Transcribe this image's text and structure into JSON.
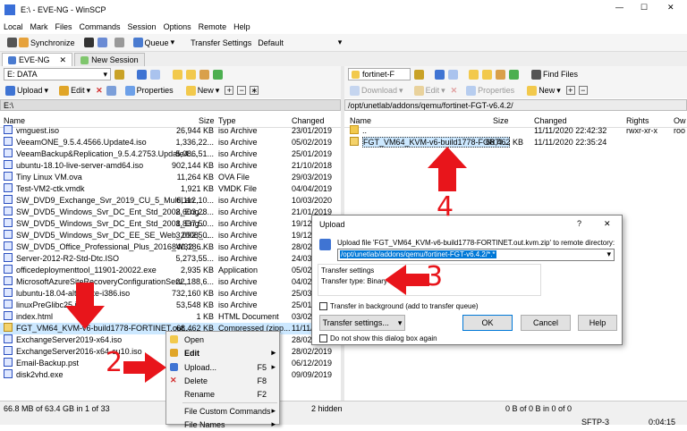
{
  "window": {
    "title": "E:\\ - EVE-NG - WinSCP"
  },
  "menu": [
    "Local",
    "Mark",
    "Files",
    "Commands",
    "Session",
    "Options",
    "Remote",
    "Help"
  ],
  "toolbar": {
    "synchronize": "Synchronize",
    "queue": "Queue",
    "transfer_settings": "Transfer Settings",
    "transfer_value": "Default"
  },
  "tabs": {
    "session": "EVE-NG",
    "new_session": "New Session"
  },
  "left": {
    "drive": "E: DATA",
    "upload": "Upload",
    "edit": "Edit",
    "properties": "Properties",
    "new": "New",
    "path": "E:\\",
    "columns": {
      "name": "Name",
      "size": "Size",
      "type": "Type",
      "changed": "Changed"
    },
    "rows": [
      {
        "name": "vmguest.iso",
        "size": "26,944 KB",
        "type": "iso Archive",
        "changed": "23/01/2019"
      },
      {
        "name": "VeeamONE_9.5.4.4566.Update4.iso",
        "size": "1,336,22...",
        "type": "iso Archive",
        "changed": "05/02/2019"
      },
      {
        "name": "VeeamBackup&Replication_9.5.4.2753.Update4....",
        "size": "5,086,51...",
        "type": "iso Archive",
        "changed": "25/01/2019"
      },
      {
        "name": "ubuntu-18.10-live-server-amd64.iso",
        "size": "902,144 KB",
        "type": "iso Archive",
        "changed": "21/10/2018"
      },
      {
        "name": "Tiny Linux VM.ova",
        "size": "11,264 KB",
        "type": "OVA File",
        "changed": "29/03/2019"
      },
      {
        "name": "Test-VM2-ctk.vmdk",
        "size": "1,921 KB",
        "type": "VMDK File",
        "changed": "04/04/2019"
      },
      {
        "name": "SW_DVD9_Exchange_Svr_2019_CU_5_MultiLan...",
        "size": "6,112,10...",
        "type": "iso Archive",
        "changed": "10/03/2020"
      },
      {
        "name": "SW_DVD5_Windows_Svr_DC_Ent_Std_2008_Eng...",
        "size": "2,603,28...",
        "type": "iso Archive",
        "changed": "21/01/2019"
      },
      {
        "name": "SW_DVD5_Windows_Svr_DC_Ent_Std_2008_Eng...",
        "size": "1,837,50...",
        "type": "iso Archive",
        "changed": "19/12/2018"
      },
      {
        "name": "SW_DVD5_Windows_Svr_DC_EE_SE_Web_2008_...",
        "size": "3,092,50...",
        "type": "iso Archive",
        "changed": "19/12/2018"
      },
      {
        "name": "SW_DVD5_Office_Professional_Plus_2016_W32_...",
        "size": "840,186 KB",
        "type": "iso Archive",
        "changed": "28/02/2019"
      },
      {
        "name": "Server-2012-R2-Std-Dtc.ISO",
        "size": "5,273,55...",
        "type": "iso Archive",
        "changed": "24/03/2019"
      },
      {
        "name": "officedeploymenttool_11901-20022.exe",
        "size": "2,935 KB",
        "type": "Application",
        "changed": "05/02/2019"
      },
      {
        "name": "MicrosoftAzureSiteRecoveryConfigurationServ...",
        "size": "22,188,6...",
        "type": "iso Archive",
        "changed": "04/02/2019"
      },
      {
        "name": "lubuntu-18.04-alternate-i386.iso",
        "size": "732,160 KB",
        "type": "iso Archive",
        "changed": "25/03/2019"
      },
      {
        "name": "linuxPreGlibc25.iso",
        "size": "53,548 KB",
        "type": "iso Archive",
        "changed": "25/01/2019"
      },
      {
        "name": "index.html",
        "size": "1 KB",
        "type": "HTML Document",
        "changed": "03/02/2020"
      },
      {
        "name": "FGT_VM64_KVM-v6-build1778-FORTINET.out....",
        "size": "68,462 KB",
        "type": "Compressed (zipp...",
        "changed": "11/11/2020"
      },
      {
        "name": "ExchangeServer2019-x64.iso",
        "size": "",
        "type": "",
        "changed": "28/02/2019"
      },
      {
        "name": "ExchangeServer2016-x64-cu10.iso",
        "size": "",
        "type": "",
        "changed": "28/02/2019"
      },
      {
        "name": "Email-Backup.pst",
        "size": "",
        "type": "",
        "changed": "06/12/2019"
      },
      {
        "name": "disk2vhd.exe",
        "size": "",
        "type": "",
        "changed": "09/09/2019"
      }
    ],
    "status": "66.8 MB of 63.4 GB in 1 of 33"
  },
  "right": {
    "drive": "fortinet-F",
    "find": "Find Files",
    "download": "Download",
    "edit": "Edit",
    "properties": "Properties",
    "new": "New",
    "path": "/opt/unetlab/addons/qemu/fortinet-FGT-v6.4.2/",
    "columns": {
      "name": "Name",
      "size": "Size",
      "changed": "Changed",
      "rights": "Rights",
      "owner": "Ow"
    },
    "rows": [
      {
        "name": "..",
        "size": "",
        "changed": "11/11/2020 22:42:32",
        "rights": "rwxr-xr-x",
        "owner": "roo"
      },
      {
        "name": "FGT_VM64_KVM-v6-build1778-FORTI...",
        "size": "68,462 KB",
        "changed": "11/11/2020 22:35:24",
        "rights": "",
        "owner": ""
      }
    ],
    "status": "2 hidden",
    "status_right": "0 B of 0 B in 0 of 0"
  },
  "context_menu": {
    "items": [
      {
        "label": "Open",
        "shortcut": ""
      },
      {
        "label": "Edit",
        "shortcut": ""
      },
      {
        "label": "Upload...",
        "shortcut": "F5"
      },
      {
        "label": "Delete",
        "shortcut": "F8"
      },
      {
        "label": "Rename",
        "shortcut": "F2"
      },
      {
        "label": "File Custom Commands",
        "shortcut": ""
      },
      {
        "label": "File Names",
        "shortcut": ""
      }
    ]
  },
  "dialog": {
    "title": "Upload",
    "help_q": "?",
    "prompt": "Upload file 'FGT_VM64_KVM-v6-build1778-FORTINET.out.kvm.zip' to remote directory:",
    "target": "/opt/unetlab/addons/qemu/fortinet-FGT-v6.4.2/*.*",
    "group": "Transfer settings",
    "transfer_type": "Transfer type: Binary",
    "background": "Transfer in background (add to transfer queue)",
    "settings_btn": "Transfer settings...",
    "ok": "OK",
    "cancel": "Cancel",
    "help": "Help",
    "dont_show": "Do not show this dialog box again"
  },
  "annotations": {
    "n2": "2",
    "n3": "3",
    "n4": "4"
  },
  "footer": {
    "sftp": "SFTP-3",
    "time": "0:04:15"
  },
  "colors": {
    "accent": "#e8151b",
    "selection": "#cce8ff"
  }
}
